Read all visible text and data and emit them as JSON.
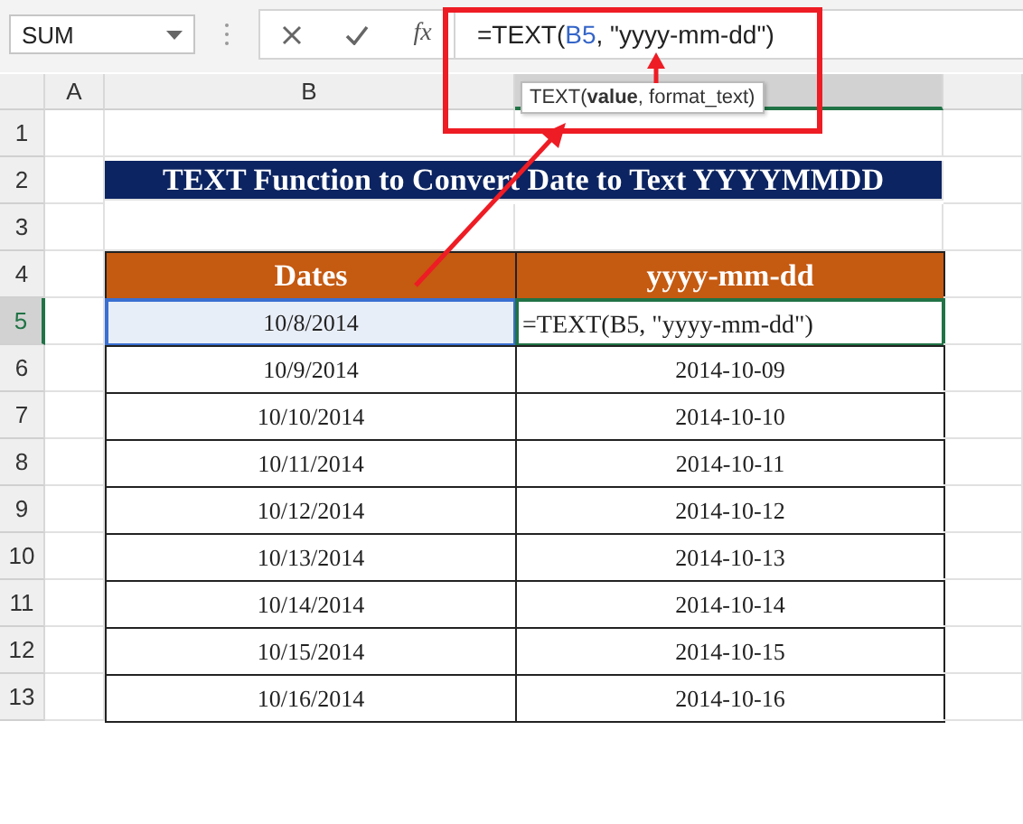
{
  "name_box": {
    "value": "SUM"
  },
  "formula_bar": {
    "function_icon": "fx",
    "prefix": "=TEXT(",
    "reference": "B5",
    "suffix": ", \"yyyy-mm-dd\")"
  },
  "tooltip": "TEXT(**value**, format_text)",
  "columns": [
    {
      "label": "A",
      "selected": false
    },
    {
      "label": "B",
      "selected": false
    },
    {
      "selected": true
    }
  ],
  "row_headers": [
    {
      "label": "1",
      "selected": false
    },
    {
      "label": "2",
      "selected": false
    },
    {
      "label": "3",
      "selected": false
    },
    {
      "label": "4",
      "selected": false
    },
    {
      "label": "5",
      "selected": true
    },
    {
      "label": "6",
      "selected": false
    },
    {
      "label": "7",
      "selected": false
    },
    {
      "label": "8",
      "selected": false
    },
    {
      "label": "9",
      "selected": false
    },
    {
      "label": "10",
      "selected": false
    },
    {
      "label": "11",
      "selected": false
    },
    {
      "label": "12",
      "selected": false
    },
    {
      "label": "13",
      "selected": false
    }
  ],
  "title": "TEXT Function to Convert Date to Text YYYYMMDD",
  "table": {
    "headers": [
      "Dates",
      "yyyy-mm-dd"
    ],
    "rows": [
      {
        "date": "10/8/2014",
        "date_selected": true,
        "result": "=TEXT(B5, \"yyyy-mm-dd\")",
        "result_editing": true
      },
      {
        "date": "10/9/2014",
        "date_selected": false,
        "result": "2014-10-09",
        "result_editing": false
      },
      {
        "date": "10/10/2014",
        "date_selected": false,
        "result": "2014-10-10",
        "result_editing": false
      },
      {
        "date": "10/11/2014",
        "date_selected": false,
        "result": "2014-10-11",
        "result_editing": false
      },
      {
        "date": "10/12/2014",
        "date_selected": false,
        "result": "2014-10-12",
        "result_editing": false
      },
      {
        "date": "10/13/2014",
        "date_selected": false,
        "result": "2014-10-13",
        "result_editing": false
      },
      {
        "date": "10/14/2014",
        "date_selected": false,
        "result": "2014-10-14",
        "result_editing": false
      },
      {
        "date": "10/15/2014",
        "date_selected": false,
        "result": "2014-10-15",
        "result_editing": false
      },
      {
        "date": "10/16/2014",
        "date_selected": false,
        "result": "2014-10-16",
        "result_editing": false
      }
    ]
  }
}
